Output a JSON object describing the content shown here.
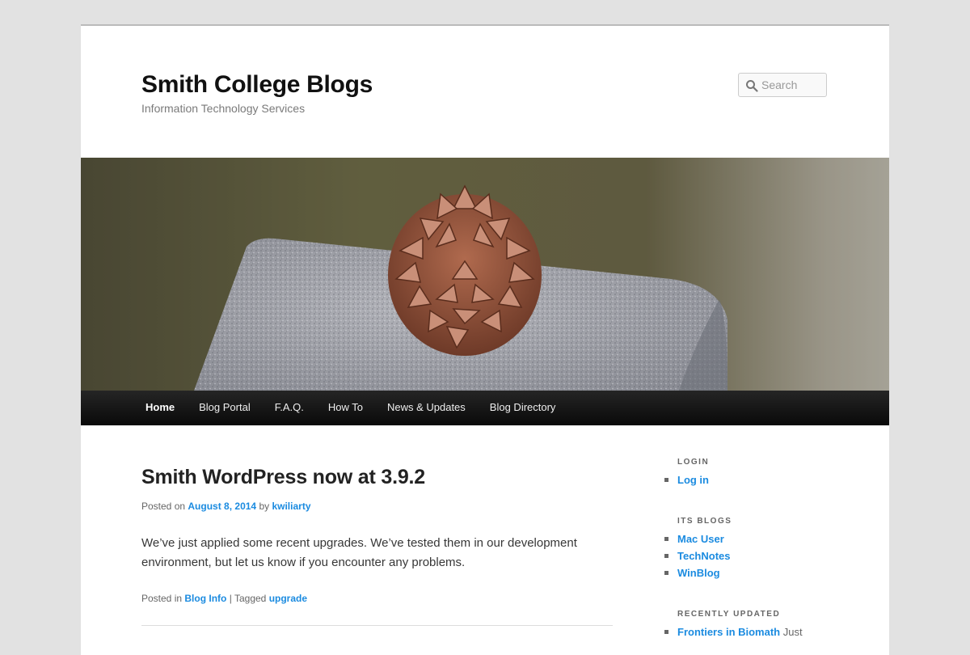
{
  "header": {
    "site_title": "Smith College Blogs",
    "site_description": "Information Technology Services",
    "search_placeholder": "Search"
  },
  "nav": {
    "items": [
      {
        "label": "Home",
        "current": true
      },
      {
        "label": "Blog Portal"
      },
      {
        "label": "F.A.Q."
      },
      {
        "label": "How To"
      },
      {
        "label": "News & Updates"
      },
      {
        "label": "Blog Directory"
      }
    ]
  },
  "post": {
    "title": "Smith WordPress now at 3.9.2",
    "posted_on_label": "Posted on",
    "date": "August 8, 2014",
    "by_label": "by",
    "author": "kwiliarty",
    "content": "We’ve just applied some recent upgrades. We’ve tested them in our development environment, but let us know if you encounter any problems.",
    "posted_in_label": "Posted in",
    "category": "Blog Info",
    "separator": "|",
    "tagged_label": "Tagged",
    "tag": "upgrade"
  },
  "sidebar": {
    "login": {
      "title": "LOGIN",
      "items": [
        {
          "label": "Log in"
        }
      ]
    },
    "its_blogs": {
      "title": "ITS BLOGS",
      "items": [
        {
          "label": "Mac User"
        },
        {
          "label": "TechNotes"
        },
        {
          "label": "WinBlog"
        }
      ]
    },
    "recently_updated": {
      "title": "RECENTLY UPDATED",
      "items": [
        {
          "label": "Frontiers in Biomath",
          "desc": "Just"
        }
      ]
    }
  }
}
